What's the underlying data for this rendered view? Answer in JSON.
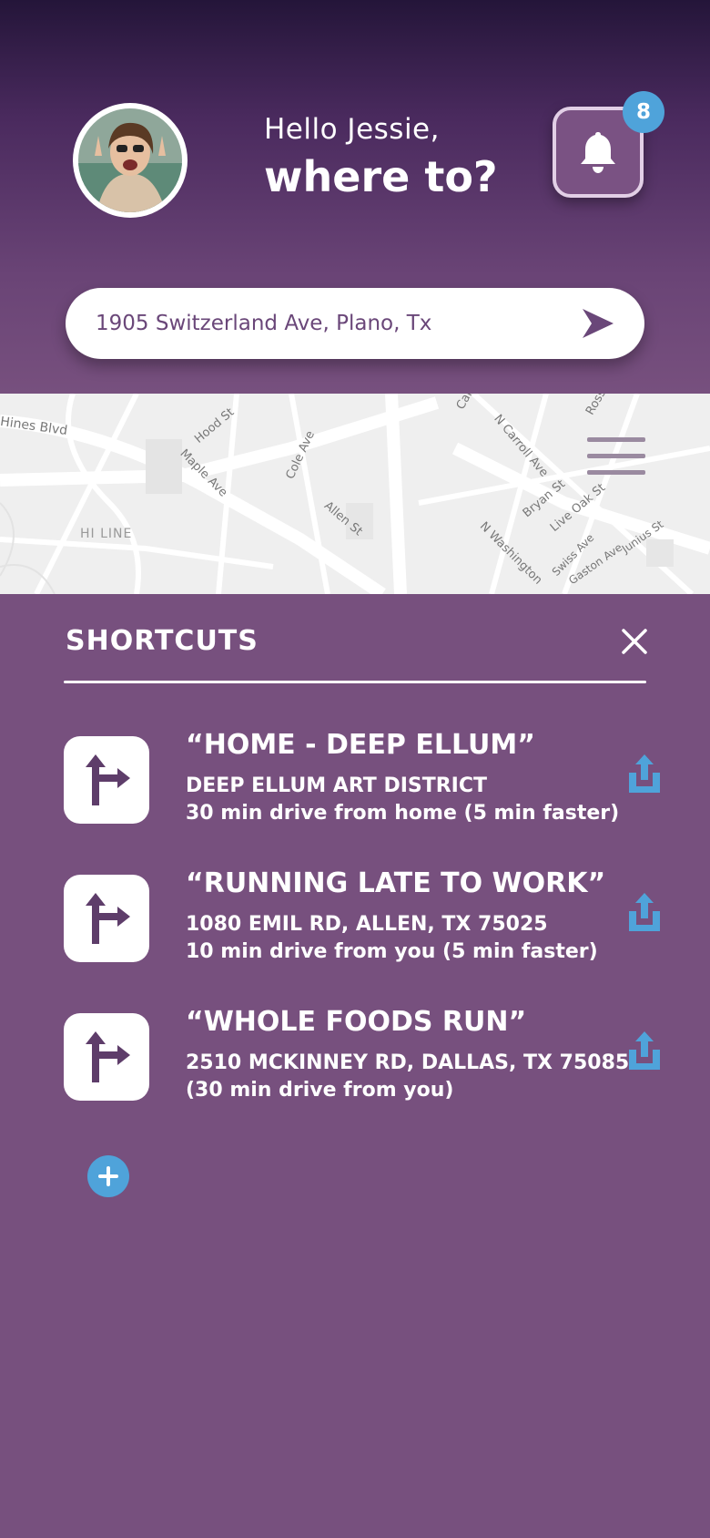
{
  "user": {
    "greeting": "Hello Jessie,",
    "headline": "where to?"
  },
  "notifications": {
    "count": "8"
  },
  "search": {
    "value": "1905 Switzerland Ave, Plano, Tx"
  },
  "map": {
    "streets": [
      "Hines Blvd",
      "Hood St",
      "Maple Ave",
      "Cole Ave",
      "HI LINE",
      "Allen St",
      "N Carroll Ave",
      "Bryan St",
      "Live Oak St",
      "N Washington",
      "Swiss Ave",
      "Gaston Ave",
      "Junius St",
      "Ross",
      "Cal"
    ]
  },
  "shortcuts": {
    "title": "SHORTCUTS",
    "items": [
      {
        "title": "“HOME - DEEP ELLUM”",
        "subtitle": "DEEP ELLUM ART DISTRICT",
        "note": "30 min drive from home (5 min faster)"
      },
      {
        "title": "“RUNNING LATE TO WORK”",
        "subtitle": "1080 EMIL RD, ALLEN, TX 75025",
        "note": "10 min drive from you (5 min faster)"
      },
      {
        "title": "“WHOLE FOODS RUN”",
        "subtitle": "2510 MCKINNEY RD, DALLAS, TX 75085",
        "note": "(30 min drive from you)"
      }
    ]
  },
  "colors": {
    "background": "#77507e",
    "accent": "#4fa3da",
    "header_top": "#241539"
  },
  "icons": [
    "avatar",
    "bell-icon",
    "send-icon",
    "menu-icon",
    "close-icon",
    "directions-icon",
    "share-icon",
    "plus-icon"
  ]
}
